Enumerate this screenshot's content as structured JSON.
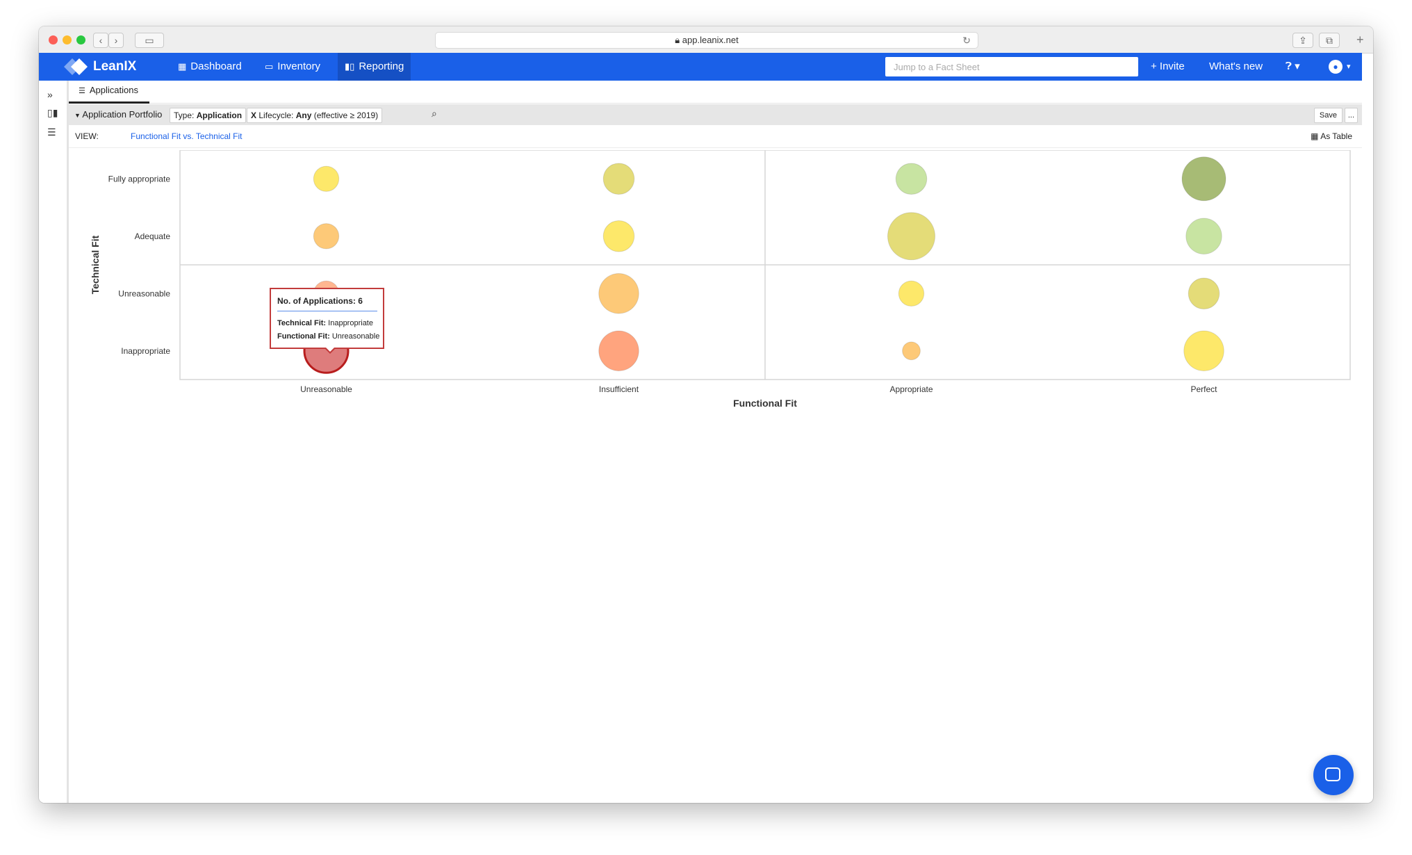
{
  "browser": {
    "url": "app.leanix.net"
  },
  "nav": {
    "brand": "LeanIX",
    "items": [
      {
        "label": "Dashboard",
        "icon": "dashboard-icon"
      },
      {
        "label": "Inventory",
        "icon": "inventory-icon"
      },
      {
        "label": "Reporting",
        "icon": "reporting-icon",
        "active": true
      }
    ],
    "search_placeholder": "Jump to a Fact Sheet",
    "invite": "+ Invite",
    "whats_new": "What's new",
    "help_icon": "help-icon",
    "user_icon": "user-icon"
  },
  "sidebar": {
    "icons": [
      "expand-icon",
      "report-icon",
      "filter-icon"
    ]
  },
  "tabs": [
    {
      "label": "Applications",
      "icon": "filter-icon"
    }
  ],
  "filterbar": {
    "title": "Application Portfolio",
    "chips": [
      {
        "key": "Type:",
        "value": "Application"
      },
      {
        "prefix": "X",
        "key": "Lifecycle:",
        "value": "Any",
        "suffix": "(effective ≥ 2019)"
      }
    ],
    "save": "Save",
    "more": "..."
  },
  "view": {
    "prefix": "VIEW:",
    "name": "Functional Fit vs. Technical Fit",
    "as_table": "As Table"
  },
  "chart_data": {
    "type": "scatter",
    "xlabel": "Functional Fit",
    "ylabel": "Technical Fit",
    "x_categories": [
      "Unreasonable",
      "Insufficient",
      "Appropriate",
      "Perfect"
    ],
    "y_categories": [
      "Fully appropriate",
      "Adequate",
      "Unreasonable",
      "Inappropriate"
    ],
    "points": [
      {
        "x": "Unreasonable",
        "y": "Fully appropriate",
        "size": 2,
        "color": "#fde86a"
      },
      {
        "x": "Insufficient",
        "y": "Fully appropriate",
        "size": 3,
        "color": "#e4dc78"
      },
      {
        "x": "Appropriate",
        "y": "Fully appropriate",
        "size": 3,
        "color": "#c8e4a2"
      },
      {
        "x": "Perfect",
        "y": "Fully appropriate",
        "size": 6,
        "color": "#a7bb75"
      },
      {
        "x": "Unreasonable",
        "y": "Adequate",
        "size": 2,
        "color": "#fdc978"
      },
      {
        "x": "Insufficient",
        "y": "Adequate",
        "size": 3,
        "color": "#fde86a"
      },
      {
        "x": "Appropriate",
        "y": "Adequate",
        "size": 7,
        "color": "#e4dc78"
      },
      {
        "x": "Perfect",
        "y": "Adequate",
        "size": 4,
        "color": "#c8e4a2"
      },
      {
        "x": "Unreasonable",
        "y": "Unreasonable",
        "size": 2,
        "color": "#ffb690"
      },
      {
        "x": "Insufficient",
        "y": "Unreasonable",
        "size": 5,
        "color": "#fdc978"
      },
      {
        "x": "Appropriate",
        "y": "Unreasonable",
        "size": 2,
        "color": "#fde86a"
      },
      {
        "x": "Perfect",
        "y": "Unreasonable",
        "size": 3,
        "color": "#e4dc78"
      },
      {
        "x": "Unreasonable",
        "y": "Inappropriate",
        "size": 6,
        "color": "#de7c7c",
        "highlighted": true
      },
      {
        "x": "Insufficient",
        "y": "Inappropriate",
        "size": 5,
        "color": "#ffa47e"
      },
      {
        "x": "Appropriate",
        "y": "Inappropriate",
        "size": 1,
        "color": "#fdc978"
      },
      {
        "x": "Perfect",
        "y": "Inappropriate",
        "size": 5,
        "color": "#fde86a"
      }
    ]
  },
  "tooltip": {
    "title": "No. of Applications: 6",
    "row1_key": "Technical Fit:",
    "row1_value": "Inappropriate",
    "row2_key": "Functional Fit:",
    "row2_value": "Unreasonable"
  },
  "chat": {
    "icon": "chat-icon"
  }
}
